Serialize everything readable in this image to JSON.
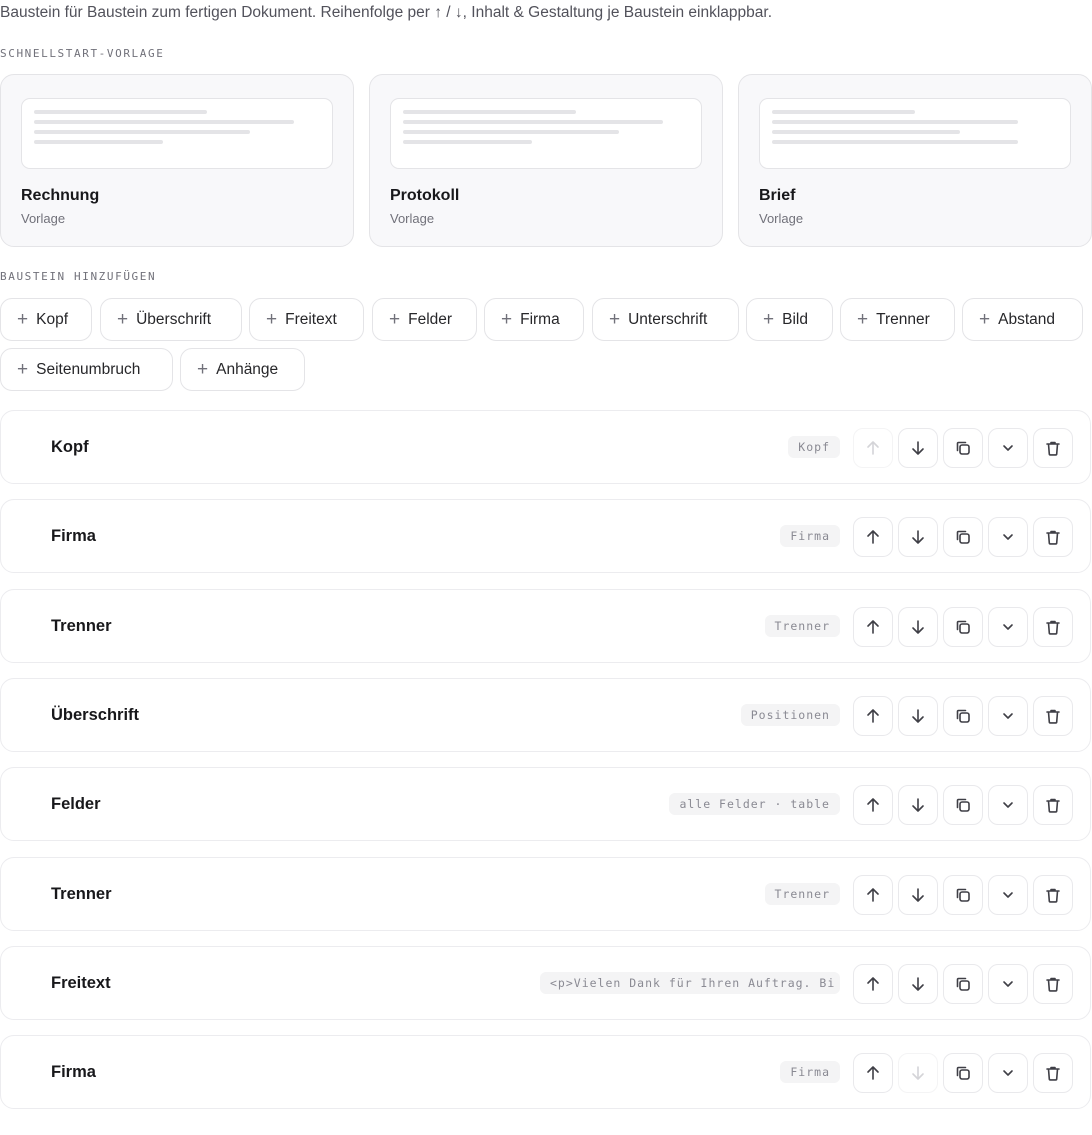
{
  "intro": "Baustein für Baustein zum fertigen Dokument. Reihenfolge per ↑ / ↓, Inhalt & Gestaltung je Baustein einklappbar.",
  "templates_section": {
    "label": "SCHNELLSTART-VORLAGE",
    "items": [
      {
        "name": "Rechnung",
        "sub": "Vorlage"
      },
      {
        "name": "Protokoll",
        "sub": "Vorlage"
      },
      {
        "name": "Brief",
        "sub": "Vorlage"
      }
    ]
  },
  "add_section": {
    "label": "BAUSTEIN HINZUFÜGEN",
    "icon": "plus-icon",
    "buttons": [
      "Kopf",
      "Überschrift",
      "Freitext",
      "Felder",
      "Firma",
      "Unterschrift",
      "Bild",
      "Trenner",
      "Abstand",
      "Seitenumbruch",
      "Anhänge"
    ]
  },
  "blocks": [
    {
      "title": "Kopf",
      "tag": "Kopf",
      "up_disabled": true,
      "down_disabled": false
    },
    {
      "title": "Firma",
      "tag": "Firma",
      "up_disabled": false,
      "down_disabled": false
    },
    {
      "title": "Trenner",
      "tag": "Trenner",
      "up_disabled": false,
      "down_disabled": false
    },
    {
      "title": "Überschrift",
      "tag": "Positionen",
      "up_disabled": false,
      "down_disabled": false
    },
    {
      "title": "Felder",
      "tag": "alle Felder · table",
      "up_disabled": false,
      "down_disabled": false
    },
    {
      "title": "Trenner",
      "tag": "Trenner",
      "up_disabled": false,
      "down_disabled": false
    },
    {
      "title": "Freitext",
      "tag": "<p>Vielen Dank für Ihren Auftrag. Bi",
      "up_disabled": false,
      "down_disabled": false
    },
    {
      "title": "Firma",
      "tag": "Firma",
      "up_disabled": false,
      "down_disabled": true
    }
  ],
  "block_actions": {
    "icons": [
      "arrow-up-icon",
      "arrow-down-icon",
      "duplicate-icon",
      "chevron-down-icon",
      "trash-icon"
    ]
  }
}
